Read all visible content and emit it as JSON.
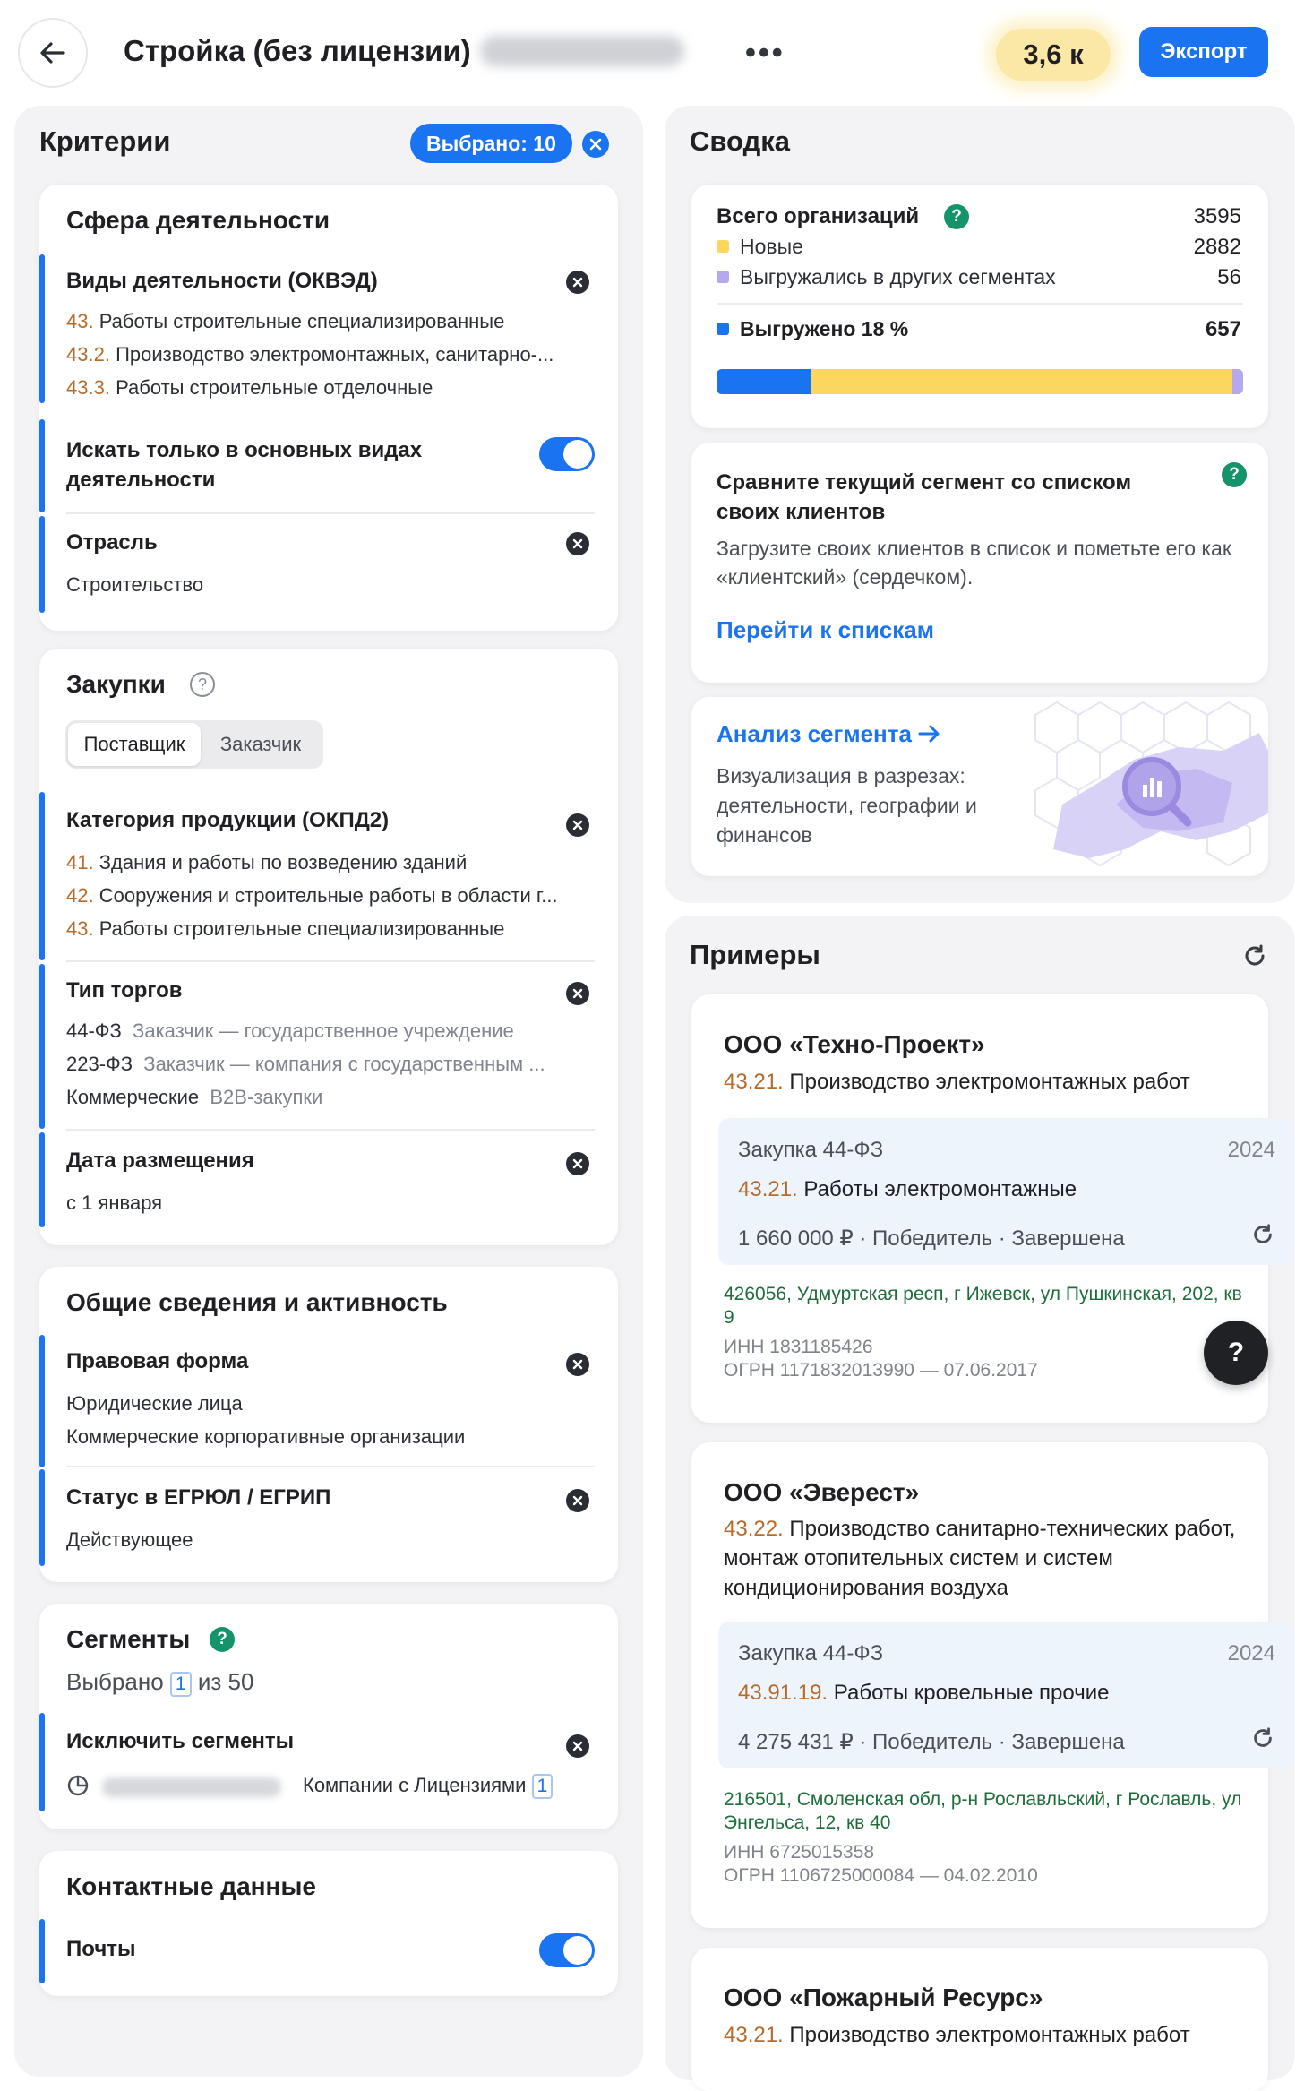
{
  "header": {
    "title": "Стройка (без лицензии)",
    "more": "•••",
    "count": "3,6 к",
    "export_label": "Экспорт"
  },
  "criteria": {
    "title": "Критерии",
    "selected_badge": "Выбрано: 10",
    "activity": {
      "title": "Сфера деятельности",
      "okved_label": "Виды деятельности (ОКВЭД)",
      "okved_items": [
        {
          "code": "43.",
          "text": "Работы строительные специализированные"
        },
        {
          "code": "43.2.",
          "text": "Производство электромонтажных, санитарно-..."
        },
        {
          "code": "43.3.",
          "text": "Работы строительные отделочные"
        }
      ],
      "main_only_label": "Искать только в основных видах деятельности",
      "industry_label": "Отрасль",
      "industry_value": "Строительство"
    },
    "purchases": {
      "title": "Закупки",
      "tab_supplier": "Поставщик",
      "tab_customer": "Заказчик",
      "okpd_label": "Категория продукции (ОКПД2)",
      "okpd_items": [
        {
          "code": "41.",
          "text": "Здания и работы по возведению зданий"
        },
        {
          "code": "42.",
          "text": "Сооружения и строительные работы в области г..."
        },
        {
          "code": "43.",
          "text": "Работы строительные специализированные"
        }
      ],
      "trade_label": "Тип торгов",
      "trade_items": [
        {
          "name": "44-ФЗ",
          "desc": "Заказчик — государственное учреждение"
        },
        {
          "name": "223-ФЗ",
          "desc": "Заказчик — компания с государственным ..."
        },
        {
          "name": "Коммерческие",
          "desc": "B2B-закупки"
        }
      ],
      "date_label": "Дата размещения",
      "date_value": "с 1 января"
    },
    "general": {
      "title": "Общие сведения и активность",
      "legal_label": "Правовая форма",
      "legal_values": [
        "Юридические лица",
        "Коммерческие корпоративные организации"
      ],
      "status_label": "Статус в ЕГРЮЛ / ЕГРИП",
      "status_value": "Действующее"
    },
    "segments": {
      "title": "Сегменты",
      "selected_prefix": "Выбрано",
      "selected_count": "1",
      "selected_total": "из 50",
      "exclude_label": "Исключить сегменты",
      "exclude_value": "Компании с Лицензиями",
      "exclude_count": "1"
    },
    "contacts": {
      "title": "Контактные данные",
      "emails_label": "Почты"
    }
  },
  "summary": {
    "title": "Сводка",
    "total_label": "Всего организаций",
    "total_value": "3595",
    "new_label": "Новые",
    "new_value": "2882",
    "other_label": "Выгружались в других сегментах",
    "other_value": "56",
    "exported_label": "Выгружено 18 %",
    "exported_value": "657",
    "progress": {
      "exported": 0.18,
      "new": 0.8,
      "other": 0.02
    },
    "colors": {
      "exported": "#1a73f0",
      "new": "#fcd75f",
      "other": "#b7a7ee"
    },
    "compare_title": "Сравните текущий сегмент со списком своих клиентов",
    "compare_text": "Загрузите своих клиентов в список и пометьте его как «клиентский» (сердечком).",
    "compare_link": "Перейти к спискам",
    "analysis_title": "Анализ сегмента",
    "analysis_text": "Визуализация в разрезах: деятельности, географии и финансов"
  },
  "examples": {
    "title": "Примеры",
    "items": [
      {
        "name": "ООО «Техно-Проект»",
        "code": "43.21.",
        "activity": "Производство электромонтажных работ",
        "purchase_type": "Закупка 44-ФЗ",
        "purchase_year": "2024",
        "purchase_code": "43.21.",
        "purchase_text": "Работы электромонтажные",
        "purchase_meta": "1 660 000 ₽ · Победитель · Завершена",
        "address": "426056, Удмуртская респ, г Ижевск, ул Пушкинская, 202, кв 9",
        "inn": "ИНН 1831185426",
        "ogrn": "ОГРН 1171832013990 — 07.06.2017"
      },
      {
        "name": "ООО «Эверест»",
        "code": "43.22.",
        "activity": "Производство санитарно-технических работ, монтаж отопительных систем и систем кондиционирования воздуха",
        "purchase_type": "Закупка 44-ФЗ",
        "purchase_year": "2024",
        "purchase_code": "43.91.19.",
        "purchase_text": "Работы кровельные прочие",
        "purchase_meta": "4 275 431 ₽ · Победитель · Завершена",
        "address": "216501, Смоленская обл, р-н Рославльский, г Рославль, ул Энгельса, 12, кв 40",
        "inn": "ИНН 6725015358",
        "ogrn": "ОГРН 1106725000084 — 04.02.2010"
      },
      {
        "name": "ООО «Пожарный Ресурс»",
        "code": "43.21.",
        "activity": "Производство электромонтажных работ"
      }
    ]
  },
  "help_button": "?"
}
